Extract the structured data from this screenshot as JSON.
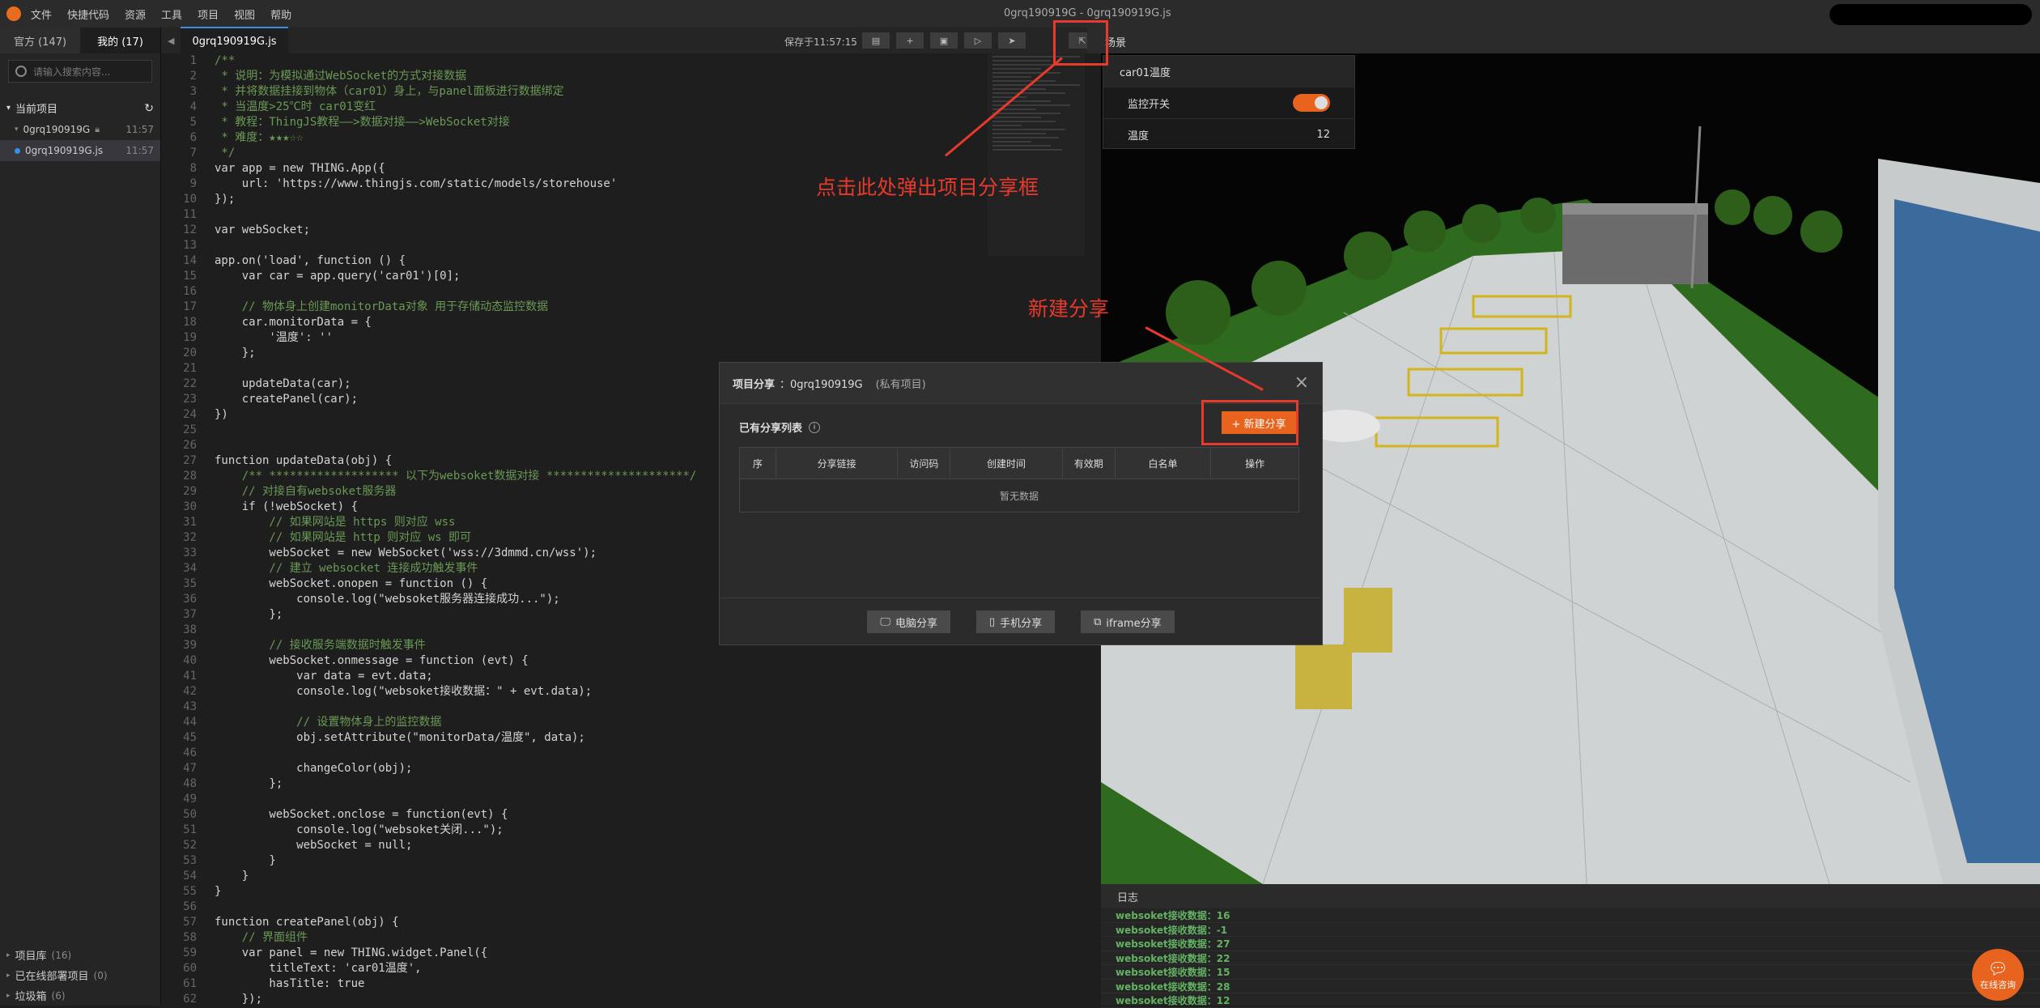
{
  "window_title": "0grq190919G - 0grq190919G.js",
  "menu": [
    "文件",
    "快捷代码",
    "资源",
    "工具",
    "项目",
    "视图",
    "帮助"
  ],
  "left": {
    "tabs": [
      "官方 (147)",
      "我的 (17)"
    ],
    "search_placeholder": "请输入搜索内容...",
    "current_project_title": "当前项目",
    "tree": [
      {
        "label": "0grq190919G",
        "time": "11:57"
      },
      {
        "label": "0grq190919G.js",
        "time": "11:57"
      }
    ],
    "bottom_sections": [
      {
        "label": "项目库",
        "count": "(16)"
      },
      {
        "label": "已在线部署项目",
        "count": "(0)"
      },
      {
        "label": "垃圾箱",
        "count": "(6)"
      }
    ]
  },
  "editor": {
    "tab": "0grq190919G.js",
    "saved": "保存于11:57:15",
    "lines": [
      "/**",
      " * 说明：为模拟通过WebSocket的方式对接数据",
      " * 并将数据挂接到物体（car01）身上，与panel面板进行数据绑定",
      " * 当温度>25℃时 car01变红",
      " * 教程：ThingJS教程——>数据对接——>WebSocket对接",
      " * 难度：★★★☆☆",
      " */",
      "var app = new THING.App({",
      "    url: 'https://www.thingjs.com/static/models/storehouse'",
      "});",
      "",
      "var webSocket;",
      "",
      "app.on('load', function () {",
      "    var car = app.query('car01')[0];",
      "",
      "    // 物体身上创建monitorData对象 用于存储动态监控数据",
      "    car.monitorData = {",
      "        '温度': ''",
      "    };",
      "",
      "    updateData(car);",
      "    createPanel(car);",
      "})",
      "",
      "",
      "function updateData(obj) {",
      "    /** ******************* 以下为websoket数据对接 *********************/",
      "    // 对接自有websoket服务器",
      "    if (!webSocket) {",
      "        // 如果网站是 https 则对应 wss",
      "        // 如果网站是 http 则对应 ws 即可",
      "        webSocket = new WebSocket('wss://3dmmd.cn/wss');",
      "        // 建立 websocket 连接成功触发事件",
      "        webSocket.onopen = function () {",
      "            console.log(\"websoket服务器连接成功...\");",
      "        };",
      "",
      "        // 接收服务端数据时触发事件",
      "        webSocket.onmessage = function (evt) {",
      "            var data = evt.data;",
      "            console.log(\"websoket接收数据：\" + evt.data);",
      "",
      "            // 设置物体身上的监控数据",
      "            obj.setAttribute(\"monitorData/温度\", data);",
      "",
      "            changeColor(obj);",
      "        };",
      "",
      "        webSocket.onclose = function(evt) {",
      "            console.log(\"websoket关闭...\");",
      "            webSocket = null;",
      "        }",
      "    }",
      "}",
      "",
      "function createPanel(obj) {",
      "    // 界面组件",
      "    var panel = new THING.widget.Panel({",
      "        titleText: 'car01温度',",
      "        hasTitle: true",
      "    });"
    ]
  },
  "scene": {
    "tab": "场景",
    "panel_title": "car01温度",
    "switch_label": "监控开关",
    "temp_label": "温度",
    "temp_value": "12"
  },
  "log": {
    "tab": "日志",
    "lines": [
      "websoket接收数据：16",
      "websoket接收数据：-1",
      "websoket接收数据：27",
      "websoket接收数据：22",
      "websoket接收数据：15",
      "websoket接收数据：28",
      "websoket接收数据：12"
    ]
  },
  "chat": "在线咨询",
  "modal": {
    "title": "项目分享",
    "project": "：0grq190919G",
    "privacy": "(私有项目)",
    "list_title": "已有分享列表",
    "new_button": "+ 新建分享",
    "columns": [
      "序",
      "分享链接",
      "访问码",
      "创建时间",
      "有效期",
      "白名单",
      "操作"
    ],
    "empty": "暂无数据",
    "footer": [
      "电脑分享",
      "手机分享",
      "iframe分享"
    ]
  },
  "annotations": {
    "top": "点击此处弹出项目分享框",
    "new_share": "新建分享"
  },
  "colors": {
    "accent": "#e8631d",
    "annotation": "#e83a2c",
    "log_green": "#62b262"
  }
}
